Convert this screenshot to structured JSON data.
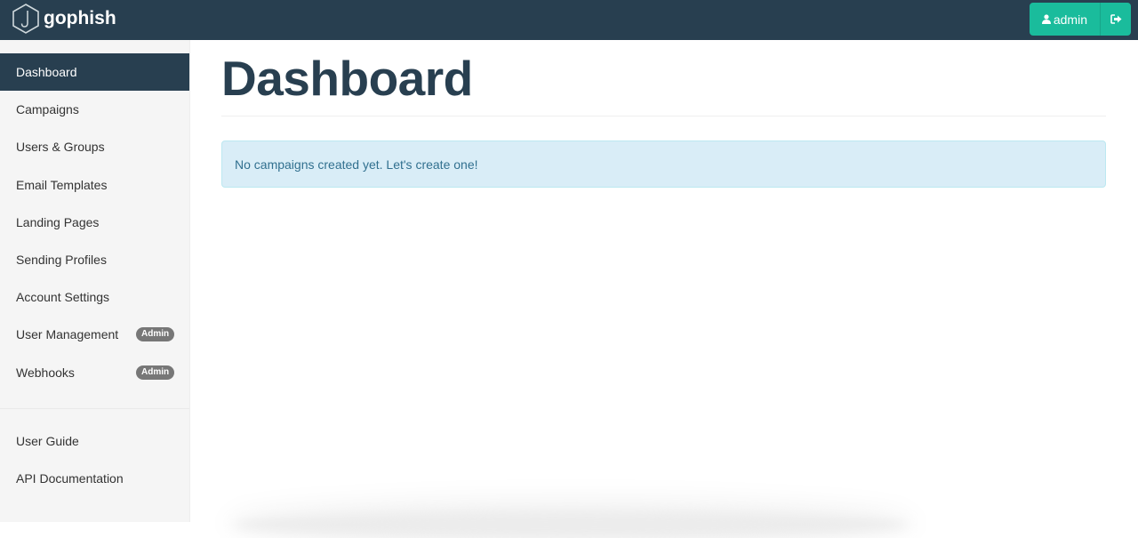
{
  "brand": {
    "name": "gophish",
    "icon": "gophish-logo-icon"
  },
  "navbar": {
    "user_label": "admin",
    "user_icon": "user-icon",
    "logout_icon": "sign-out-icon"
  },
  "sidebar": {
    "items": [
      {
        "label": "Dashboard",
        "active": true
      },
      {
        "label": "Campaigns"
      },
      {
        "label": "Users & Groups"
      },
      {
        "label": "Email Templates"
      },
      {
        "label": "Landing Pages"
      },
      {
        "label": "Sending Profiles"
      },
      {
        "label": "Account Settings"
      },
      {
        "label": "User Management",
        "badge": "Admin"
      },
      {
        "label": "Webhooks",
        "badge": "Admin"
      }
    ],
    "secondary_items": [
      {
        "label": "User Guide"
      },
      {
        "label": "API Documentation"
      }
    ]
  },
  "main": {
    "title": "Dashboard",
    "alert": "No campaigns created yet. Let's create one!"
  },
  "colors": {
    "navbar_bg": "#283f50",
    "accent": "#1abc9c",
    "alert_bg": "#d9edf7",
    "alert_text": "#31708f",
    "badge_bg": "#777777"
  }
}
